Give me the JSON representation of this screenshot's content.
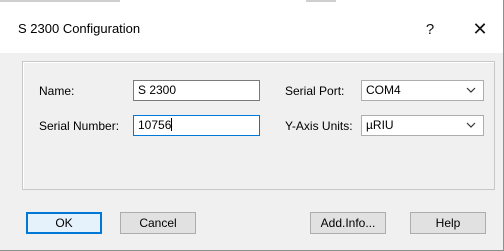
{
  "window": {
    "title": "S 2300 Configuration",
    "help_glyph": "?",
    "close_glyph": "✕"
  },
  "form": {
    "name_label": "Name:",
    "name_value": "S 2300",
    "serial_number_label": "Serial Number:",
    "serial_number_value": "10756",
    "serial_port_label": "Serial Port:",
    "serial_port_value": "COM4",
    "y_axis_units_label": "Y-Axis Units:",
    "y_axis_units_value": "µRIU"
  },
  "buttons": {
    "ok": "OK",
    "cancel": "Cancel",
    "add_info": "Add.Info...",
    "help": "Help"
  },
  "colors": {
    "focus_accent": "#0078d7",
    "dialog_background": "#f0f0f0"
  }
}
